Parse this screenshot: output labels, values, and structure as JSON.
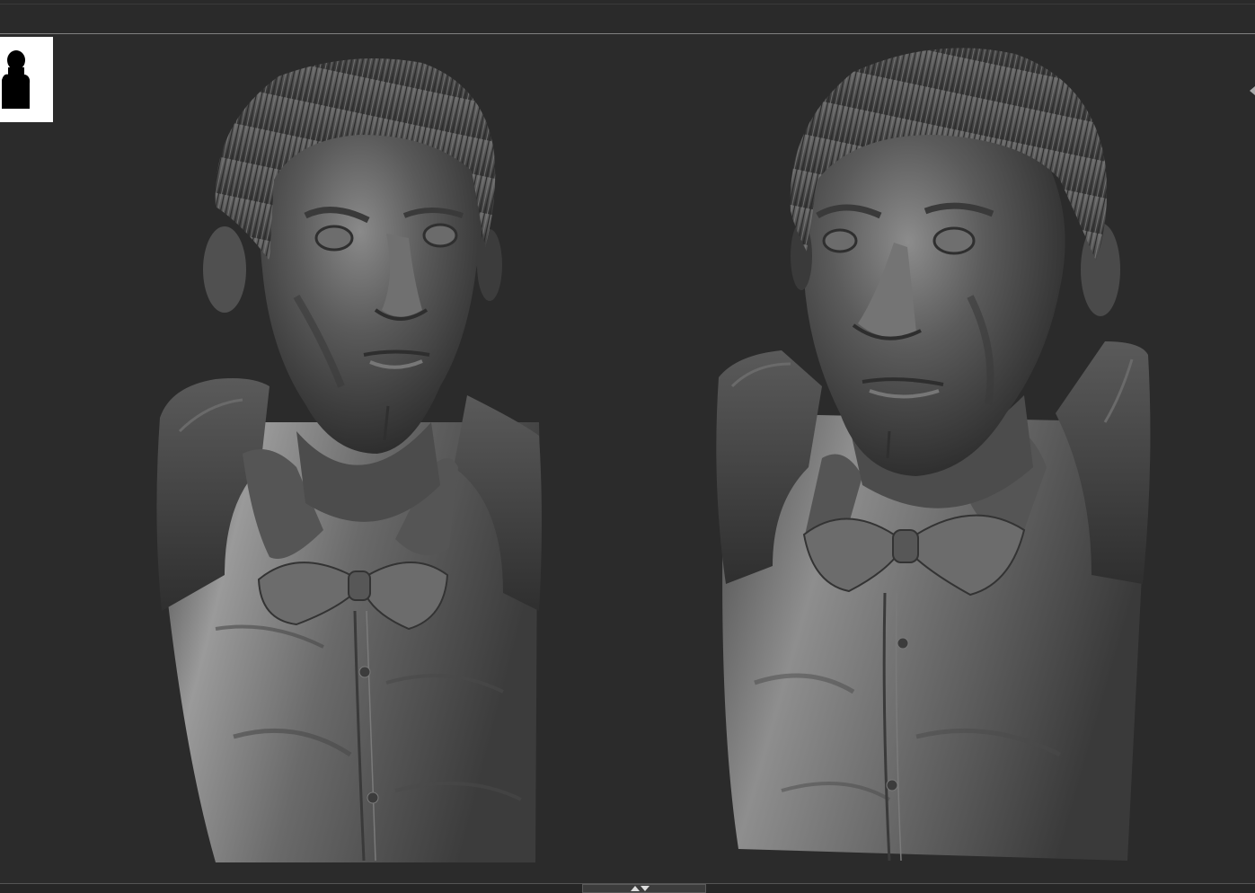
{
  "viewport": {
    "background": "#2b2b2b",
    "models": [
      {
        "name": "bust-front-view",
        "material": "matcap-gray"
      },
      {
        "name": "bust-three-quarter-view",
        "material": "matcap-gray"
      }
    ]
  },
  "navigator": {
    "icon": "bust-silhouette-icon"
  },
  "bottom_bar": {
    "icon": "collapse-expand-arrows-icon"
  }
}
